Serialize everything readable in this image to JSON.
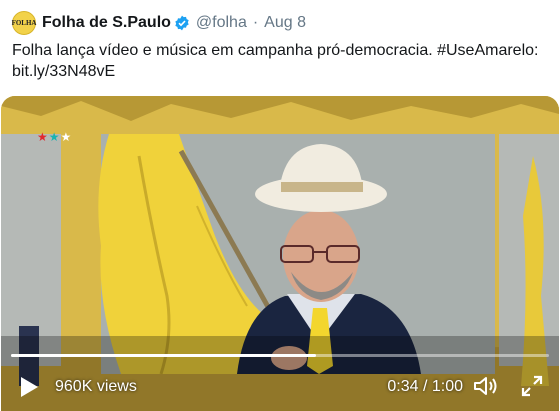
{
  "account": {
    "avatar_text": "FOLHA",
    "display_name": "Folha de S.Paulo",
    "handle": "@folha",
    "separator": "·",
    "date": "Aug 8"
  },
  "tweet": {
    "text": "Folha lança vídeo e música em campanha pró-democracia. #UseAmarelo: bit.ly/33N48vE"
  },
  "video": {
    "views": "960K views",
    "time": "0:34 / 1:00",
    "progress_fraction": 0.567,
    "colors": {
      "background": "#d9b94a",
      "flag": "#f0d23a",
      "jacket": "#1a2540",
      "tie": "#f3d62e",
      "hat": "#f1ece0"
    }
  }
}
